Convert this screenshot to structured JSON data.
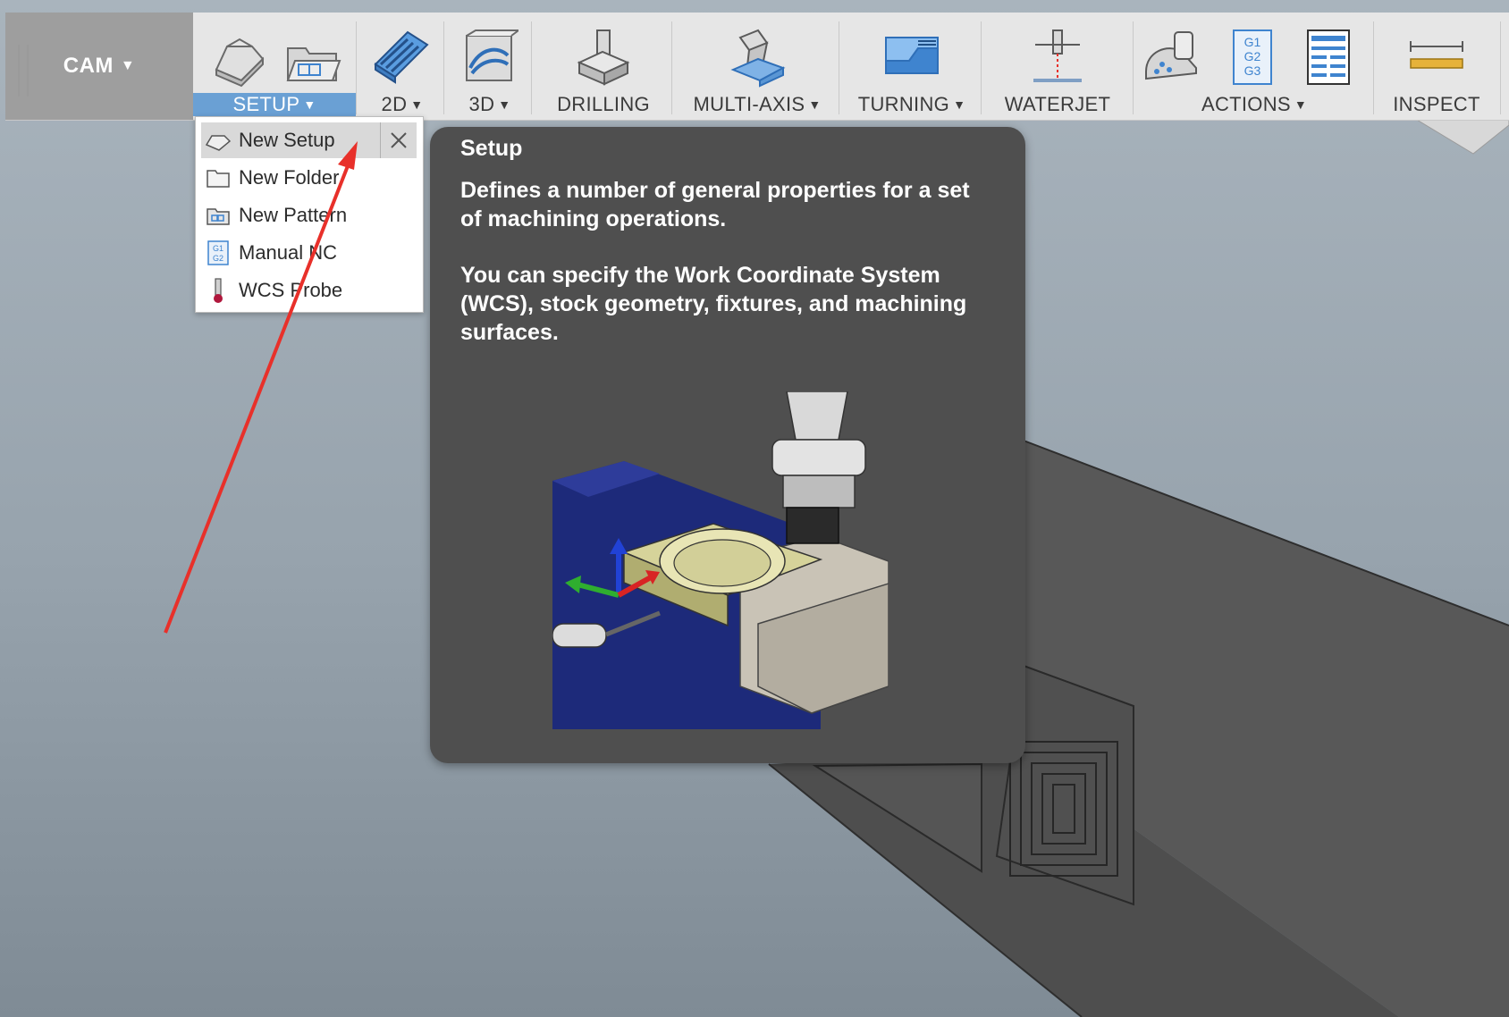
{
  "workspace": {
    "label": "CAM",
    "caret": "▼"
  },
  "toolbar": {
    "groups": [
      {
        "label": "SETUP",
        "caret": "▼"
      },
      {
        "label": "2D",
        "caret": "▼"
      },
      {
        "label": "3D",
        "caret": "▼"
      },
      {
        "label": "DRILLING",
        "caret": ""
      },
      {
        "label": "MULTI-AXIS",
        "caret": "▼"
      },
      {
        "label": "TURNING",
        "caret": "▼"
      },
      {
        "label": "WATERJET",
        "caret": ""
      },
      {
        "label": "ACTIONS",
        "caret": "▼"
      },
      {
        "label": "INSPECT",
        "caret": ""
      }
    ],
    "icons": {
      "setup": [
        "new-setup-icon",
        "new-folder-setup-icon"
      ],
      "2d": "2d-adaptive-icon",
      "3d": "3d-adaptive-icon",
      "drilling": "drill-icon",
      "multi_axis": "multi-axis-icon",
      "turning": "turning-icon",
      "waterjet": "waterjet-icon",
      "actions": [
        "simulate-icon",
        "post-process-icon",
        "setup-sheet-icon"
      ],
      "actions_gcode": [
        "G1",
        "G2",
        "G3"
      ],
      "inspect": "measure-icon"
    }
  },
  "setup_menu": {
    "items": [
      {
        "label": "New Setup",
        "icon": "new-setup-icon"
      },
      {
        "label": "New Folder",
        "icon": "folder-icon"
      },
      {
        "label": "New Pattern",
        "icon": "pattern-icon"
      },
      {
        "label": "Manual NC",
        "icon": "manual-nc-icon",
        "icon_text": [
          "G1",
          "G2"
        ]
      },
      {
        "label": "WCS Probe",
        "icon": "probe-icon"
      }
    ],
    "close": "close-icon"
  },
  "tooltip": {
    "title": "Setup",
    "description": "Defines a number of general properties for a set of machining operations.",
    "detail": "You can specify the Work Coordinate System (WCS), stock geometry, fixtures, and machining surfaces."
  },
  "colors": {
    "toolbar_bg": "#e6e6e6",
    "workspace_bg": "#9e9e9e",
    "active_group": "#6aa0d4",
    "tooltip_bg": "#4f4f4f",
    "annotation_arrow": "#e8302a",
    "icon_blue": "#3f84cf"
  }
}
